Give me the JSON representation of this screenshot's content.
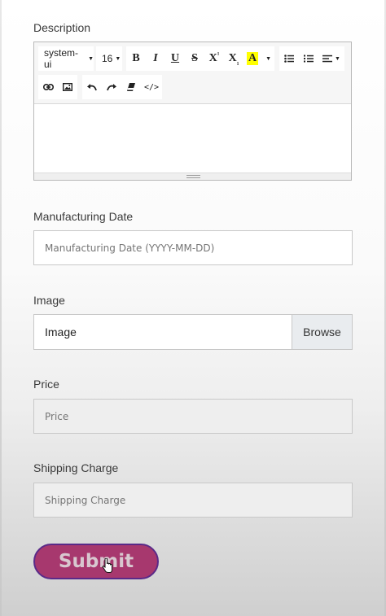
{
  "description": {
    "label": "Description",
    "toolbar": {
      "font_family": "system-ui",
      "font_size": "16",
      "bold": "B",
      "italic": "I",
      "underline": "U",
      "strike": "S",
      "superscript": "X",
      "superscript_mark": "¹",
      "subscript": "X",
      "subscript_mark": "₁",
      "font_color": "A",
      "caret": "▼",
      "code_view": "</>"
    },
    "icons": [
      "bold-icon",
      "italic-icon",
      "underline-icon",
      "strikethrough-icon",
      "superscript-icon",
      "subscript-icon",
      "font-color-icon",
      "unordered-list-icon",
      "ordered-list-icon",
      "align-icon",
      "link-icon",
      "image-icon",
      "undo-icon",
      "redo-icon",
      "eraser-icon",
      "code-view-icon"
    ],
    "highlight_color": "#ffff00"
  },
  "manufacturing_date": {
    "label": "Manufacturing Date",
    "placeholder": "Manufacturing Date (YYYY-MM-DD)"
  },
  "image": {
    "label": "Image",
    "value": "Image",
    "browse_label": "Browse"
  },
  "price": {
    "label": "Price",
    "placeholder": "Price"
  },
  "shipping_charge": {
    "label": "Shipping Charge",
    "placeholder": "Shipping Charge"
  },
  "submit": {
    "label": "Submit",
    "background": "#a7386e",
    "border": "#5a2a88"
  }
}
